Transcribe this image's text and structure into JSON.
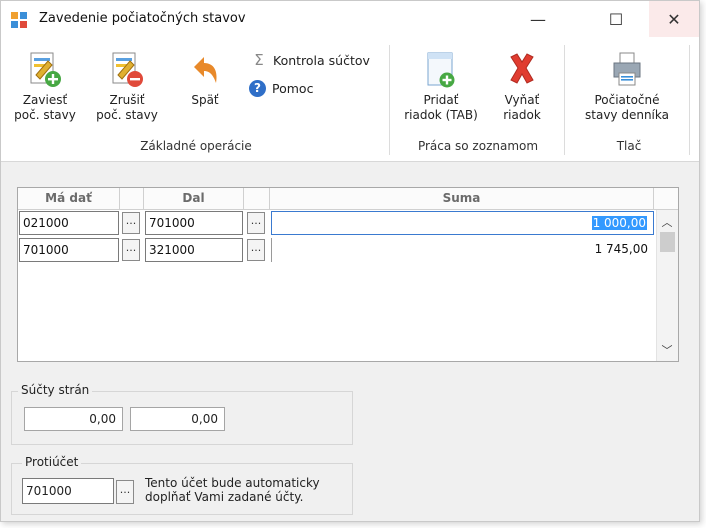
{
  "window": {
    "title": "Zavedenie počiatočných stavov",
    "minimize": "—",
    "maximize": "☐",
    "close": "✕"
  },
  "ribbon": {
    "groups": [
      {
        "label": "Základné operácie"
      },
      {
        "label": "Práca so zoznamom"
      },
      {
        "label": "Tlač"
      }
    ],
    "buttons": {
      "zaviest_line1": "Zaviesť",
      "zaviest_line2": "poč. stavy",
      "zrusit_line1": "Zrušiť",
      "zrusit_line2": "poč. stavy",
      "spat": "Späť",
      "kontrola_suctov": "Kontrola súčtov",
      "pomoc": "Pomoc",
      "pridat_line1": "Pridať",
      "pridat_line2": "riadok (TAB)",
      "vynat_line1": "Vyňať",
      "vynat_line2": "riadok",
      "pocstavy_line1": "Počiatočné",
      "pocstavy_line2": "stavy denníka"
    }
  },
  "grid": {
    "columns": [
      "Má dať",
      "Dal",
      "Suma"
    ],
    "rows": [
      {
        "ma_dat": "021000",
        "dal": "701000",
        "suma": "1 000,00"
      },
      {
        "ma_dat": "701000",
        "dal": "321000",
        "suma": "1 745,00"
      }
    ],
    "ellipsis": "..."
  },
  "sucty_stran": {
    "title": "Súčty strán",
    "left_value": "0,00",
    "right_value": "0,00"
  },
  "protiucet": {
    "title": "Protiúčet",
    "value": "701000",
    "ellipsis": "...",
    "note_line1": "Tento účet bude automaticky",
    "note_line2": "doplňať Vami zadané účty."
  }
}
